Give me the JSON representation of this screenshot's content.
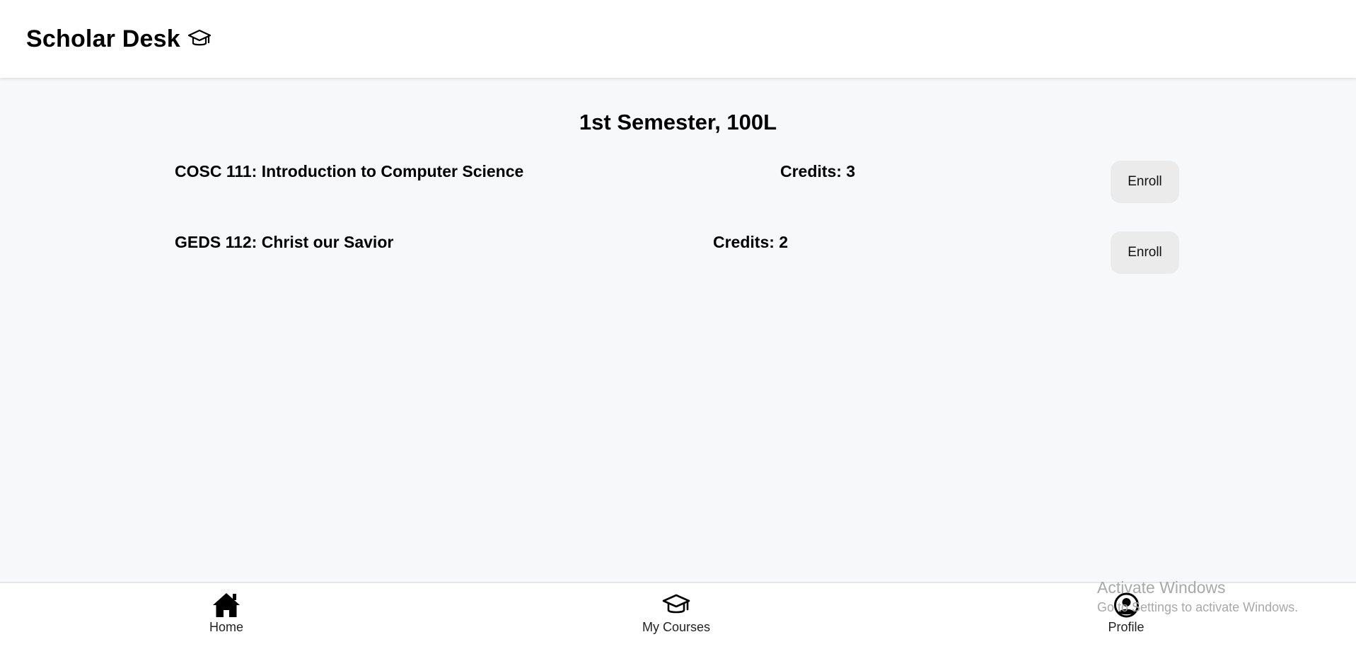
{
  "header": {
    "title": "Scholar Desk",
    "icon": "graduation-cap-icon"
  },
  "semester": {
    "title": "1st Semester, 100L"
  },
  "courses": [
    {
      "name": "COSC 111: Introduction to Computer Science",
      "credits": "Credits: 3",
      "action": "Enroll"
    },
    {
      "name": "GEDS 112: Christ our Savior",
      "credits": "Credits: 2",
      "action": "Enroll"
    }
  ],
  "bottom_nav": {
    "items": [
      {
        "label": "Home",
        "icon": "home-icon"
      },
      {
        "label": "My Courses",
        "icon": "graduation-cap-icon"
      },
      {
        "label": "Profile",
        "icon": "user-circle-icon"
      }
    ]
  },
  "watermark": {
    "title": "Activate Windows",
    "subtitle": "Go to Settings to activate Windows."
  },
  "colors": {
    "background": "#f7f8fa",
    "surface": "#ffffff",
    "button": "#ebebeb",
    "text": "#000000"
  }
}
